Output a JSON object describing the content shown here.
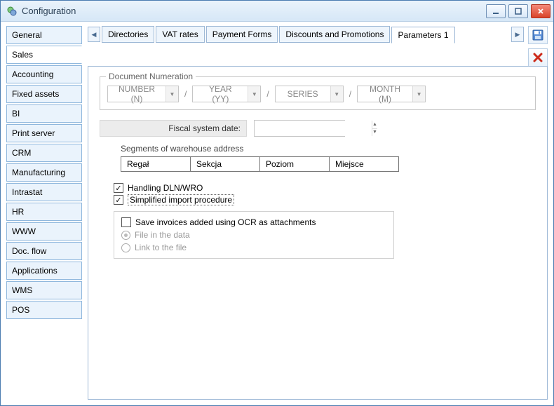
{
  "window": {
    "title": "Configuration"
  },
  "sidebar": {
    "items": [
      {
        "label": "General"
      },
      {
        "label": "Sales"
      },
      {
        "label": "Accounting"
      },
      {
        "label": "Fixed assets"
      },
      {
        "label": "BI"
      },
      {
        "label": "Print server"
      },
      {
        "label": "CRM"
      },
      {
        "label": "Manufacturing"
      },
      {
        "label": "Intrastat"
      },
      {
        "label": "HR"
      },
      {
        "label": "WWW"
      },
      {
        "label": "Doc. flow"
      },
      {
        "label": "Applications"
      },
      {
        "label": "WMS"
      },
      {
        "label": "POS"
      }
    ],
    "active_index": 1
  },
  "tabs": {
    "items": [
      {
        "label": "Directories"
      },
      {
        "label": "VAT rates"
      },
      {
        "label": "Payment Forms"
      },
      {
        "label": "Discounts and Promotions"
      },
      {
        "label": "Parameters 1"
      }
    ],
    "active_index": 4
  },
  "doc_numeration": {
    "title": "Document Numeration",
    "parts": [
      "NUMBER (N)",
      "YEAR (YY)",
      "SERIES",
      "MONTH (M)"
    ],
    "separator": "/"
  },
  "fiscal": {
    "label": "Fiscal system date:",
    "value": ""
  },
  "warehouse": {
    "title": "Segments of warehouse address",
    "cells": [
      "Regał",
      "Sekcja",
      "Poziom",
      "Miejsce"
    ]
  },
  "checks": {
    "dln_wro": {
      "label": "Handling DLN/WRO",
      "checked": true
    },
    "simplified": {
      "label": "Simplified import procedure",
      "checked": true
    }
  },
  "ocr": {
    "save_label": "Save invoices added using OCR as attachments",
    "save_checked": false,
    "mode_file": "File in the data",
    "mode_link": "Link to the file",
    "selected": "file"
  }
}
